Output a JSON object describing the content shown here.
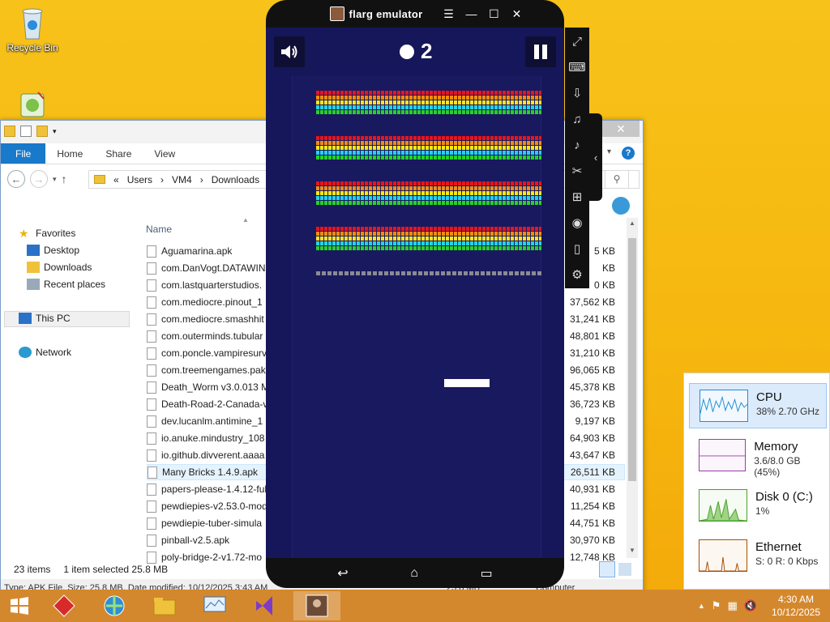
{
  "desktop": {
    "icons": [
      {
        "label": "Recycle Bin"
      }
    ]
  },
  "explorer": {
    "ribbon_tabs": [
      "File",
      "Home",
      "Share",
      "View"
    ],
    "address": {
      "prefix": "«",
      "parts": [
        "Users",
        "VM4",
        "Downloads"
      ]
    },
    "nav_pane": {
      "favorites": "Favorites",
      "desktop": "Desktop",
      "downloads": "Downloads",
      "recent": "Recent places",
      "this_pc": "This PC",
      "network": "Network"
    },
    "column_name": "Name",
    "files": [
      {
        "name": "Aguamarina.apk",
        "size": "5 KB"
      },
      {
        "name": "com.DanVogt.DATAWIN",
        "size": "KB"
      },
      {
        "name": "com.lastquarterstudios.",
        "size": "0 KB"
      },
      {
        "name": "com.mediocre.pinout_1",
        "size": "37,562 KB"
      },
      {
        "name": "com.mediocre.smashhit",
        "size": "31,241 KB"
      },
      {
        "name": "com.outerminds.tubular",
        "size": "48,801 KB"
      },
      {
        "name": "com.poncle.vampiresurv",
        "size": "31,210 KB"
      },
      {
        "name": "com.treemengames.pak",
        "size": "96,065 KB"
      },
      {
        "name": "Death_Worm v3.0.013 M",
        "size": "45,378 KB"
      },
      {
        "name": "Death-Road-2-Canada-v",
        "size": "36,723 KB"
      },
      {
        "name": "dev.lucanlm.antimine_1",
        "size": "9,197 KB"
      },
      {
        "name": "io.anuke.mindustry_108",
        "size": "64,903 KB"
      },
      {
        "name": "io.github.divverent.aaaa",
        "size": "43,647 KB"
      },
      {
        "name": "Many Bricks 1.4.9.apk",
        "size": "26,511 KB"
      },
      {
        "name": "papers-please-1.4.12-full",
        "size": "40,931 KB"
      },
      {
        "name": "pewdiepies-v2.53.0-mod",
        "size": "11,254 KB"
      },
      {
        "name": "pewdiepie-tuber-simula",
        "size": "44,751 KB"
      },
      {
        "name": "pinball-v2.5.apk",
        "size": "30,970 KB"
      },
      {
        "name": "poly-bridge-2-v1.72-mo",
        "size": "12,748 KB"
      }
    ],
    "status": {
      "items": "23 items",
      "selected": "1 item selected  25.8 MB"
    },
    "details": "Type: APK File, Size: 25.8 MB, Date modified: 10/12/2025 3:43 AM",
    "details_size": "25.8 MB",
    "details_location": "Computer"
  },
  "emulator": {
    "title": "flarg emulator",
    "score": "2",
    "brick_colors": [
      "#e8141e",
      "#f08c14",
      "#ffe614",
      "#22d2f0",
      "#28d228"
    ],
    "colors": {
      "bg": "#16165a",
      "field": "#19195f"
    }
  },
  "taskmgr": {
    "cpu": {
      "title": "CPU",
      "value": "38%  2.70 GHz"
    },
    "memory": {
      "title": "Memory",
      "value": "3.6/8.0 GB (45%)"
    },
    "disk": {
      "title": "Disk 0 (C:)",
      "value": "1%"
    },
    "ethernet": {
      "title": "Ethernet",
      "value": "S: 0  R: 0 Kbps"
    }
  },
  "taskbar": {
    "time": "4:30 AM",
    "date": "10/12/2025"
  }
}
